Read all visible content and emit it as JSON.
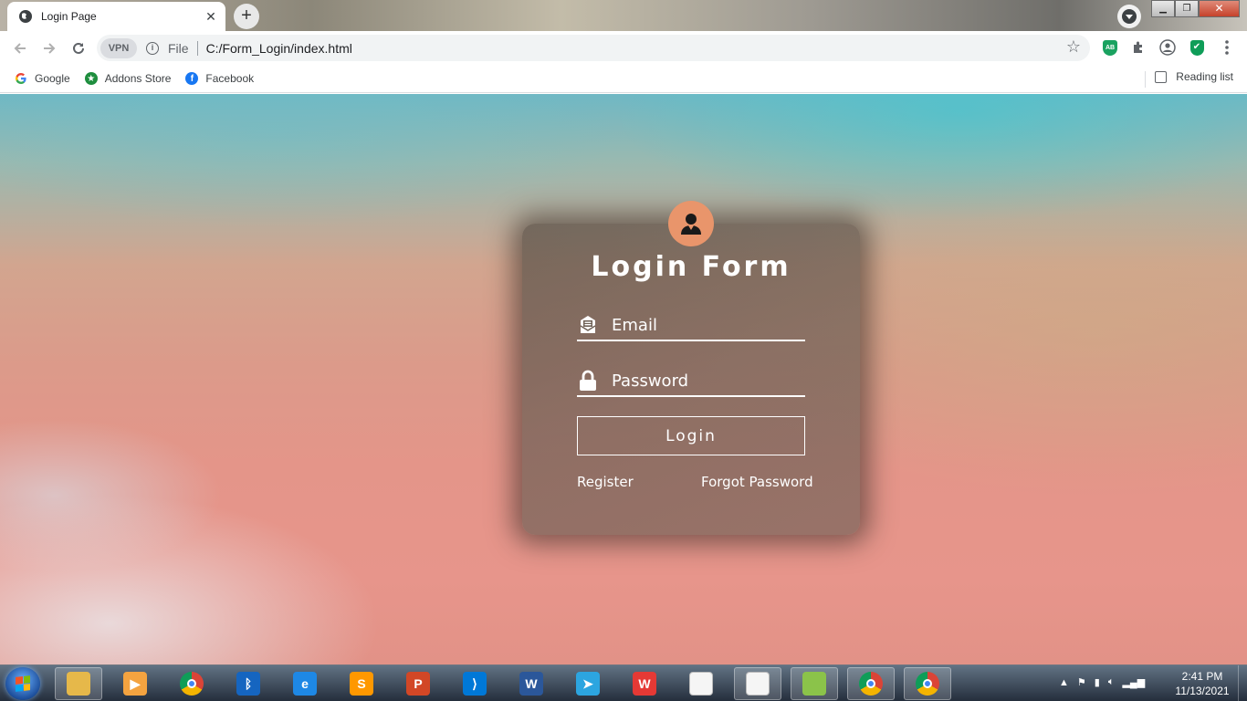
{
  "browser": {
    "tab": {
      "title": "Login Page",
      "close_symbol": "✕"
    },
    "new_tab_symbol": "+",
    "window_controls": {
      "minimize": "▁",
      "maximize": "❐",
      "close": "✕"
    },
    "toolbar": {
      "vpn_label": "VPN",
      "scheme_label": "File",
      "url": "C:/Form_Login/index.html",
      "star_symbol": "☆"
    },
    "extensions": {
      "adblock_label": "AB",
      "shield_symbol": "✔"
    },
    "bookmarks": [
      {
        "label": "Google",
        "icon": "google-icon",
        "color": "#4285f4"
      },
      {
        "label": "Addons Store",
        "icon": "addons-store-icon",
        "color": "#1e8e3e"
      },
      {
        "label": "Facebook",
        "icon": "facebook-icon",
        "color": "#1877f2"
      }
    ],
    "reading_list_label": "Reading list"
  },
  "login": {
    "title": "Login Form",
    "email_placeholder": "Email",
    "password_placeholder": "Password",
    "login_button": "Login",
    "register_link": "Register",
    "forgot_link": "Forgot Password",
    "avatar_color": "#e9956b"
  },
  "taskbar": {
    "apps": [
      {
        "name": "file-explorer",
        "glyph": "",
        "color": "#e6b84a",
        "active": true
      },
      {
        "name": "media-player",
        "glyph": "▶",
        "color": "#f4a340",
        "active": false
      },
      {
        "name": "chrome",
        "glyph": "",
        "color": "#db4437",
        "active": false
      },
      {
        "name": "bluetooth",
        "glyph": "ᛒ",
        "color": "#1565c0",
        "active": false
      },
      {
        "name": "internet-explorer",
        "glyph": "e",
        "color": "#1e88e5",
        "active": false
      },
      {
        "name": "sublime-text",
        "glyph": "S",
        "color": "#ff9800",
        "active": false
      },
      {
        "name": "powerpoint",
        "glyph": "P",
        "color": "#d24726",
        "active": false
      },
      {
        "name": "vs-code",
        "glyph": "⟩",
        "color": "#0078d7",
        "active": false
      },
      {
        "name": "word",
        "glyph": "W",
        "color": "#2b579a",
        "active": false
      },
      {
        "name": "telegram",
        "glyph": "➤",
        "color": "#2ca5e0",
        "active": false
      },
      {
        "name": "wps",
        "glyph": "W",
        "color": "#e53935",
        "active": false
      },
      {
        "name": "notepad",
        "glyph": "",
        "color": "#f5f5f5",
        "active": false
      },
      {
        "name": "document",
        "glyph": "",
        "color": "#f5f5f5",
        "active": true
      },
      {
        "name": "notepad-plus",
        "glyph": "",
        "color": "#8bc34a",
        "active": true
      },
      {
        "name": "chrome-window-1",
        "glyph": "",
        "color": "#db4437",
        "active": true
      },
      {
        "name": "chrome-window-2",
        "glyph": "",
        "color": "#db4437",
        "active": true
      }
    ],
    "time": "2:41 PM",
    "date": "11/13/2021"
  }
}
